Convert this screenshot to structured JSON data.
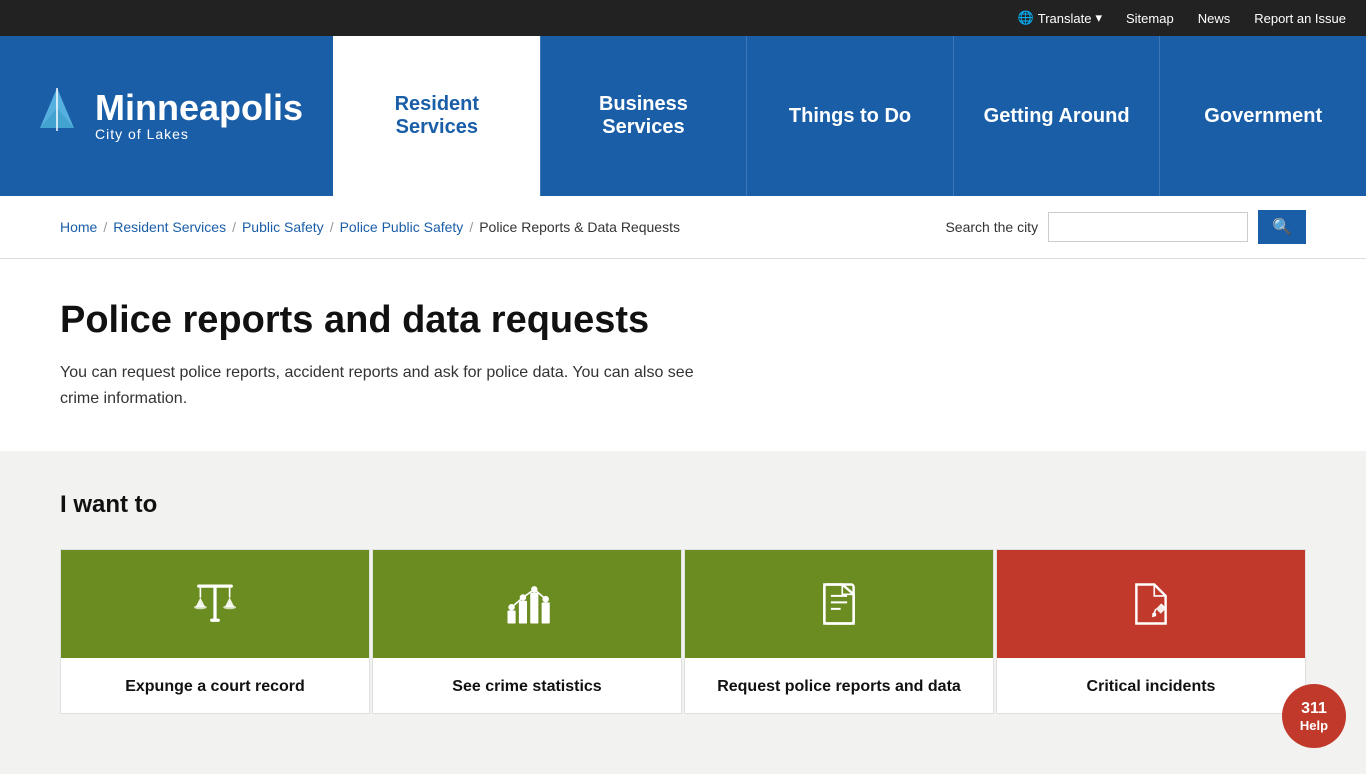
{
  "topbar": {
    "translate_label": "Translate",
    "sitemap_label": "Sitemap",
    "news_label": "News",
    "report_label": "Report an Issue"
  },
  "logo": {
    "city_name": "Minneapolis",
    "city_sub": "City of Lakes"
  },
  "nav": {
    "items": [
      {
        "id": "resident-services",
        "label": "Resident Services",
        "active": true
      },
      {
        "id": "business-services",
        "label": "Business Services",
        "active": false
      },
      {
        "id": "things-to-do",
        "label": "Things to Do",
        "active": false
      },
      {
        "id": "getting-around",
        "label": "Getting Around",
        "active": false
      },
      {
        "id": "government",
        "label": "Government",
        "active": false
      }
    ]
  },
  "breadcrumb": {
    "items": [
      {
        "label": "Home",
        "link": true
      },
      {
        "label": "Resident Services",
        "link": true
      },
      {
        "label": "Public Safety",
        "link": true
      },
      {
        "label": "Police Public Safety",
        "link": true
      },
      {
        "label": "Police Reports & Data Requests",
        "link": false
      }
    ]
  },
  "search": {
    "label": "Search the city",
    "placeholder": ""
  },
  "main": {
    "title": "Police reports and data requests",
    "description": "You can request police reports, accident reports and ask for police data. You can also see crime information."
  },
  "i_want_to": {
    "section_title": "I want to",
    "cards": [
      {
        "label": "Expunge a court record",
        "icon": "scales",
        "color": "green"
      },
      {
        "label": "See crime statistics",
        "icon": "chart",
        "color": "green"
      },
      {
        "label": "Request police reports and data",
        "icon": "document",
        "color": "green"
      },
      {
        "label": "Critical incidents",
        "icon": "document-edit",
        "color": "red"
      }
    ]
  },
  "help": {
    "number": "311",
    "label": "Help"
  }
}
